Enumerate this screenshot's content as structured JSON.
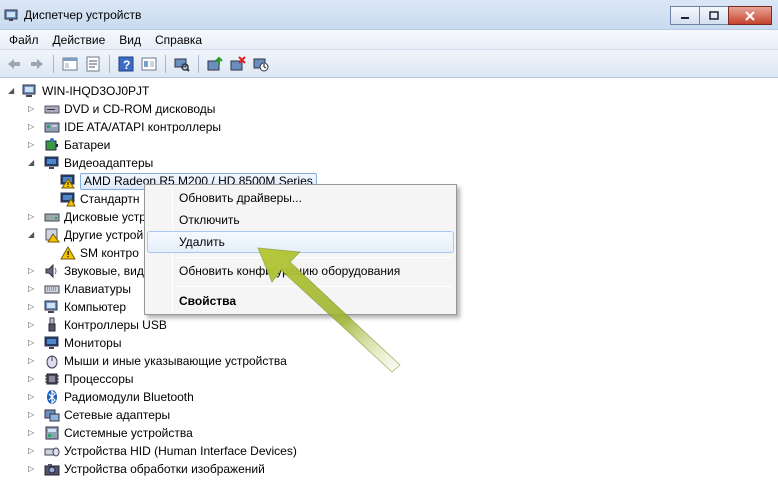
{
  "window": {
    "title": "Диспетчер устройств",
    "buttons": [
      "minimize",
      "maximize",
      "close"
    ]
  },
  "menu": [
    "Файл",
    "Действие",
    "Вид",
    "Справка"
  ],
  "toolbar": {
    "icons": [
      "back-icon",
      "forward-icon",
      "show-hide-tree-icon",
      "properties-icon",
      "help-icon",
      "view-icon",
      "scan-hardware-icon",
      "update-driver-icon",
      "uninstall-icon",
      "disable-icon"
    ]
  },
  "tree": {
    "root": "WIN-IHQD3OJ0PJT",
    "items": [
      {
        "label": "DVD и CD-ROM дисководы",
        "expanded": false
      },
      {
        "label": "IDE ATA/ATAPI контроллеры",
        "expanded": false
      },
      {
        "label": "Батареи",
        "expanded": false
      },
      {
        "label": "Видеоадаптеры",
        "expanded": true
      },
      {
        "label": "AMD Radeon R5 M200 / HD 8500M Series",
        "child": true,
        "selected": true
      },
      {
        "label": "Стандартн",
        "child": true
      },
      {
        "label": "Дисковые устр",
        "expanded": false
      },
      {
        "label": "Другие устрой",
        "expanded": true
      },
      {
        "label": "SM контро",
        "child": true
      },
      {
        "label": "Звуковые, виде",
        "expanded": false
      },
      {
        "label": "Клавиатуры",
        "expanded": false
      },
      {
        "label": "Компьютер",
        "expanded": false
      },
      {
        "label": "Контроллеры USB",
        "expanded": false
      },
      {
        "label": "Мониторы",
        "expanded": false
      },
      {
        "label": "Мыши и иные указывающие устройства",
        "expanded": false
      },
      {
        "label": "Процессоры",
        "expanded": false
      },
      {
        "label": "Радиомодули Bluetooth",
        "expanded": false
      },
      {
        "label": "Сетевые адаптеры",
        "expanded": false
      },
      {
        "label": "Системные устройства",
        "expanded": false
      },
      {
        "label": "Устройства HID (Human Interface Devices)",
        "expanded": false
      },
      {
        "label": "Устройства обработки изображений",
        "expanded": false
      }
    ]
  },
  "context_menu": {
    "items": [
      "Обновить драйверы...",
      "Отключить",
      "Удалить",
      "Обновить конфигурацию оборудования",
      "Свойства"
    ],
    "highlighted": "Удалить"
  },
  "colors": {
    "arrow": "#9bb02a",
    "selection_border": "#84acdd",
    "warning": "#f2c500"
  }
}
